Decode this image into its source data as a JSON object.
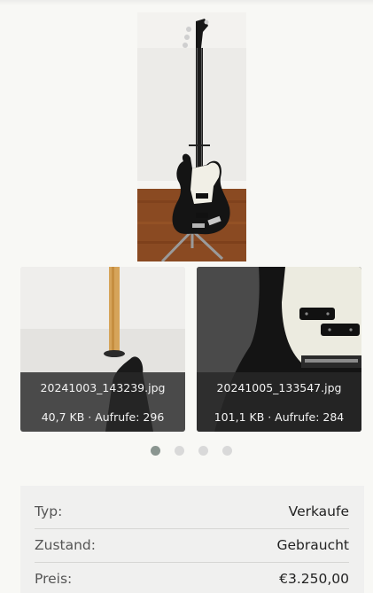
{
  "gallery": {
    "main_photo": {
      "subject": "black electric bass guitar on stand",
      "colors": {
        "wall": "#ecebe8",
        "floor": "#8a4a22",
        "body": "#141414",
        "pickguard": "#f1efe6"
      }
    },
    "thumbnails": [
      {
        "filename": "20241003_143239.jpg",
        "meta": "40,7 KB · Aufrufe: 296"
      },
      {
        "filename": "20241005_133547.jpg",
        "meta": "101,1 KB · Aufrufe: 284"
      }
    ],
    "dots": {
      "count": 4,
      "active_index": 0,
      "active_color": "#8a9590",
      "inactive_color": "#d9d9d9"
    }
  },
  "details": {
    "rows": [
      {
        "label": "Typ:",
        "value": "Verkaufe"
      },
      {
        "label": "Zustand:",
        "value": "Gebraucht"
      },
      {
        "label": "Preis:",
        "value": "€3.250,00"
      }
    ]
  }
}
